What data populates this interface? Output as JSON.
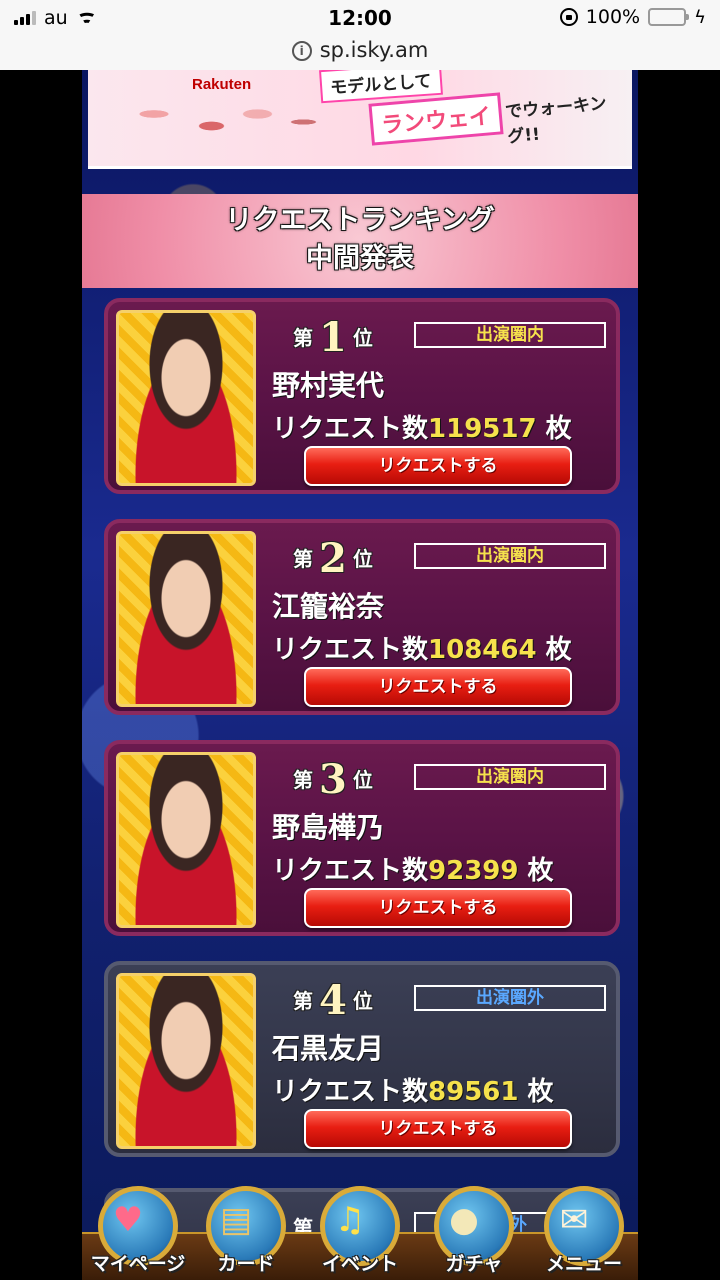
{
  "status_bar": {
    "carrier": "au",
    "time": "12:00",
    "battery": "100%"
  },
  "url_bar": {
    "url": "sp.isky.am"
  },
  "banner": {
    "brand": "Rakuten",
    "line1": "モデルとして",
    "runway": "ランウェイ",
    "runway_suffix": "でウォーキング!!"
  },
  "header": {
    "title_line1": "リクエストランキング",
    "title_line2": "中間発表"
  },
  "ranking": [
    {
      "prefix": "第",
      "rank": "1",
      "suffix": "位",
      "status": "出演圏内",
      "name": "野村実代",
      "count_label": "リクエスト数",
      "count": "119517",
      "unit": "枚",
      "button": "リクエストする"
    },
    {
      "prefix": "第",
      "rank": "2",
      "suffix": "位",
      "status": "出演圏内",
      "name": "江籠裕奈",
      "count_label": "リクエスト数",
      "count": "108464",
      "unit": "枚",
      "button": "リクエストする"
    },
    {
      "prefix": "第",
      "rank": "3",
      "suffix": "位",
      "status": "出演圏内",
      "name": "野島樺乃",
      "count_label": "リクエスト数",
      "count": "92399",
      "unit": "枚",
      "button": "リクエストする"
    },
    {
      "prefix": "第",
      "rank": "4",
      "suffix": "位",
      "status": "出演圏外",
      "name": "石黒友月",
      "count_label": "リクエスト数",
      "count": "89561",
      "unit": "枚",
      "button": "リクエストする"
    }
  ],
  "partial_card": {
    "prefix": "第",
    "status": "圏外"
  },
  "nav": [
    {
      "label": "マイページ",
      "icon": "heart-gift-icon"
    },
    {
      "label": "カード",
      "icon": "cards-icon"
    },
    {
      "label": "イベント",
      "icon": "music-note-icon"
    },
    {
      "label": "ガチャ",
      "icon": "crystal-ball-icon"
    },
    {
      "label": "メニュー",
      "icon": "menu-letter-icon"
    }
  ],
  "colors": {
    "in_status": "#f6e24c",
    "out_status": "#5aa8ff",
    "button": "#e81e12"
  }
}
